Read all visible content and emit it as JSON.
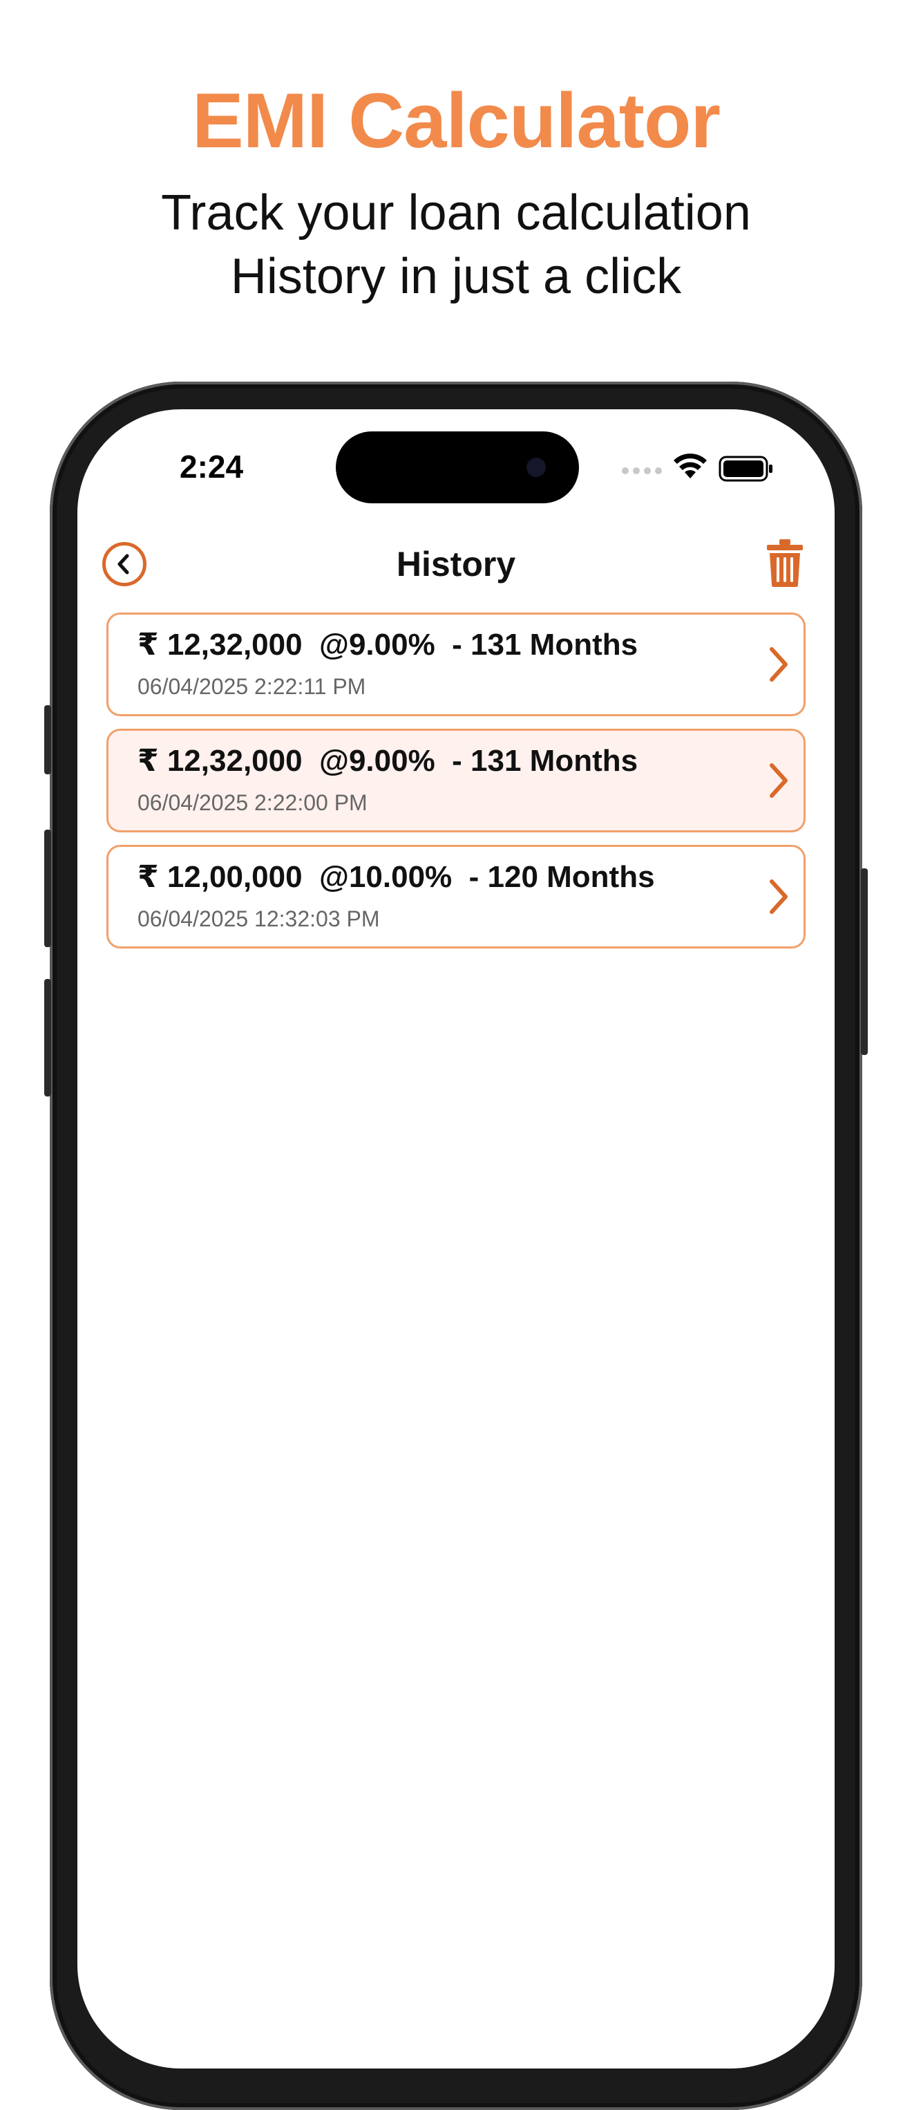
{
  "promo": {
    "title": "EMI Calculator",
    "subtitle_line1": "Track your loan calculation",
    "subtitle_line2": "History in just a click"
  },
  "status_bar": {
    "time": "2:24"
  },
  "nav": {
    "title": "History",
    "back_icon": "chevron-left-circle-icon",
    "delete_icon": "trash-icon"
  },
  "colors": {
    "accent": "#f28a4b",
    "accent_dark": "#d9692a",
    "card_border": "#f0a06a",
    "selected_bg": "#fff1ee"
  },
  "history": [
    {
      "amount": "₹ 12,32,000",
      "rate": "@9.00%",
      "tenure": "- 131 Months",
      "timestamp": "06/04/2025 2:22:11 PM"
    },
    {
      "amount": "₹ 12,32,000",
      "rate": "@9.00%",
      "tenure": "- 131 Months",
      "timestamp": "06/04/2025 2:22:00 PM"
    },
    {
      "amount": "₹ 12,00,000",
      "rate": "@10.00%",
      "tenure": "- 120 Months",
      "timestamp": "06/04/2025 12:32:03 PM"
    }
  ]
}
